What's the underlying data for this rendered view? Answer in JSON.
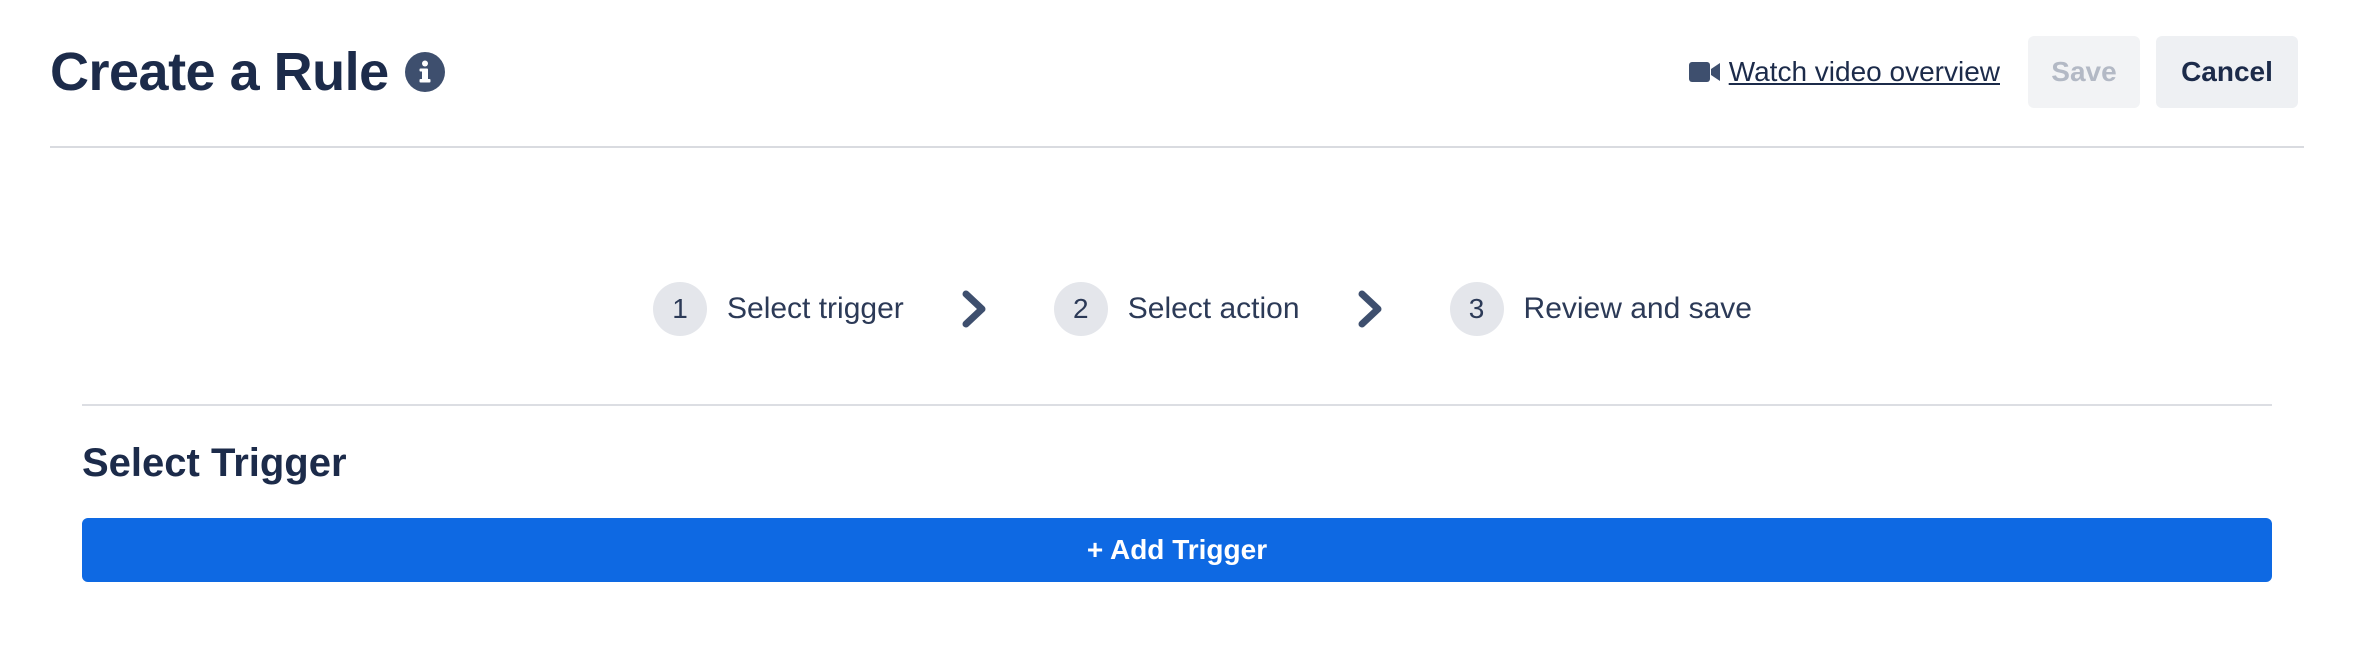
{
  "header": {
    "title": "Create a Rule",
    "info_icon": "info-circle-icon",
    "video_icon": "video-camera-icon",
    "video_link_label": "Watch video overview",
    "save_label": "Save",
    "cancel_label": "Cancel"
  },
  "stepper": {
    "steps": [
      {
        "number": "1",
        "label": "Select trigger"
      },
      {
        "number": "2",
        "label": "Select action"
      },
      {
        "number": "3",
        "label": "Review and save"
      }
    ],
    "separator_icon": "chevron-right-icon"
  },
  "section": {
    "title": "Select Trigger",
    "add_trigger_label": "+ Add Trigger"
  },
  "colors": {
    "primary": "#0e69e3",
    "text_dark": "#1c2b4a",
    "disabled_text": "#b3b9c5",
    "step_circle_bg": "#e4e6eb"
  }
}
